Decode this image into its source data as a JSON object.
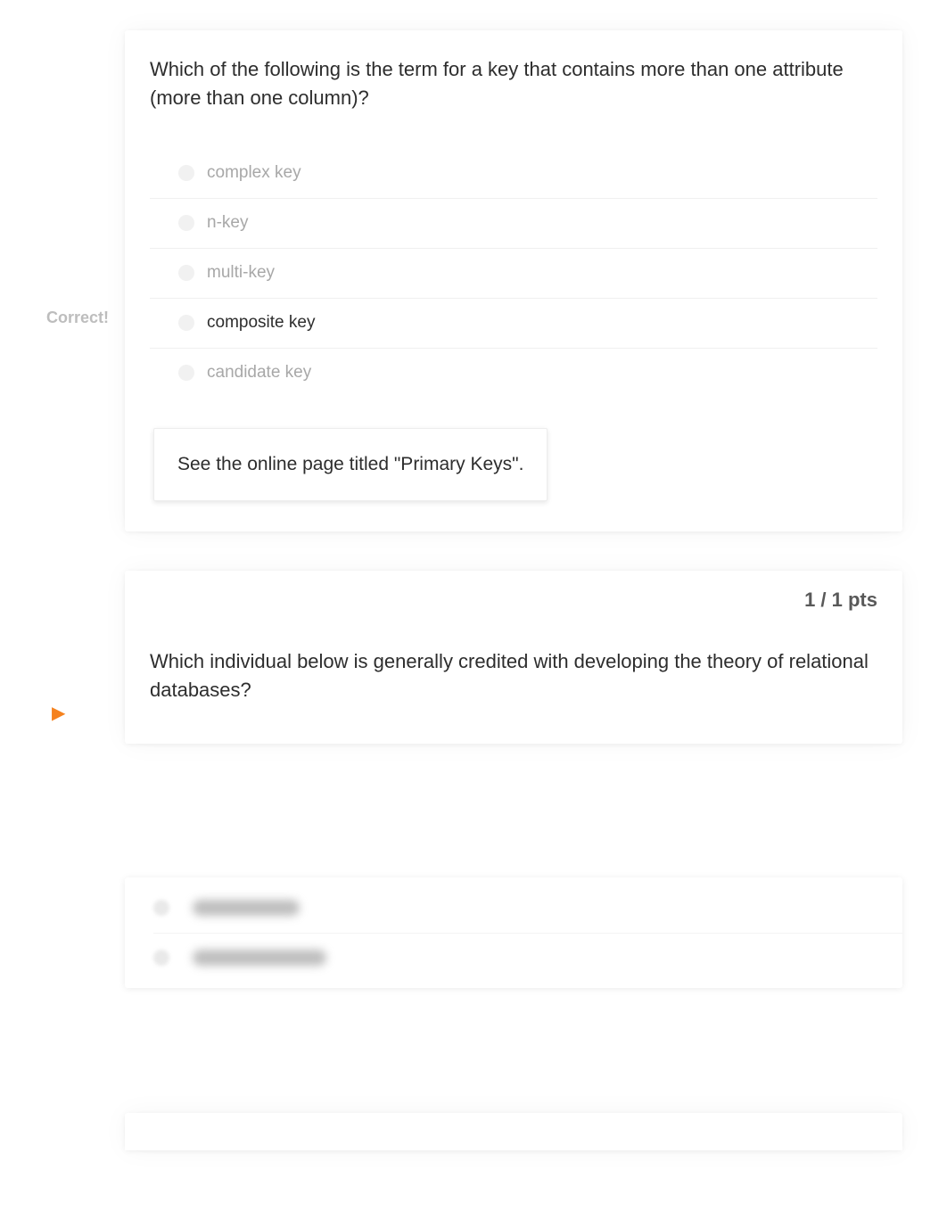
{
  "question1": {
    "text": "Which of the following is the term for a key that contains more than one attribute (more than one column)?",
    "options": [
      {
        "label": "complex key",
        "selected": false,
        "correct_marker": ""
      },
      {
        "label": "n-key",
        "selected": false,
        "correct_marker": ""
      },
      {
        "label": "multi-key",
        "selected": false,
        "correct_marker": ""
      },
      {
        "label": "composite key",
        "selected": true,
        "correct_marker": "Correct!"
      },
      {
        "label": "candidate key",
        "selected": false,
        "correct_marker": ""
      }
    ],
    "feedback": "See the online page titled \"Primary Keys\"."
  },
  "question2": {
    "points": "1 / 1 pts",
    "text": "Which individual below is generally credited with developing the theory of relational databases?"
  }
}
